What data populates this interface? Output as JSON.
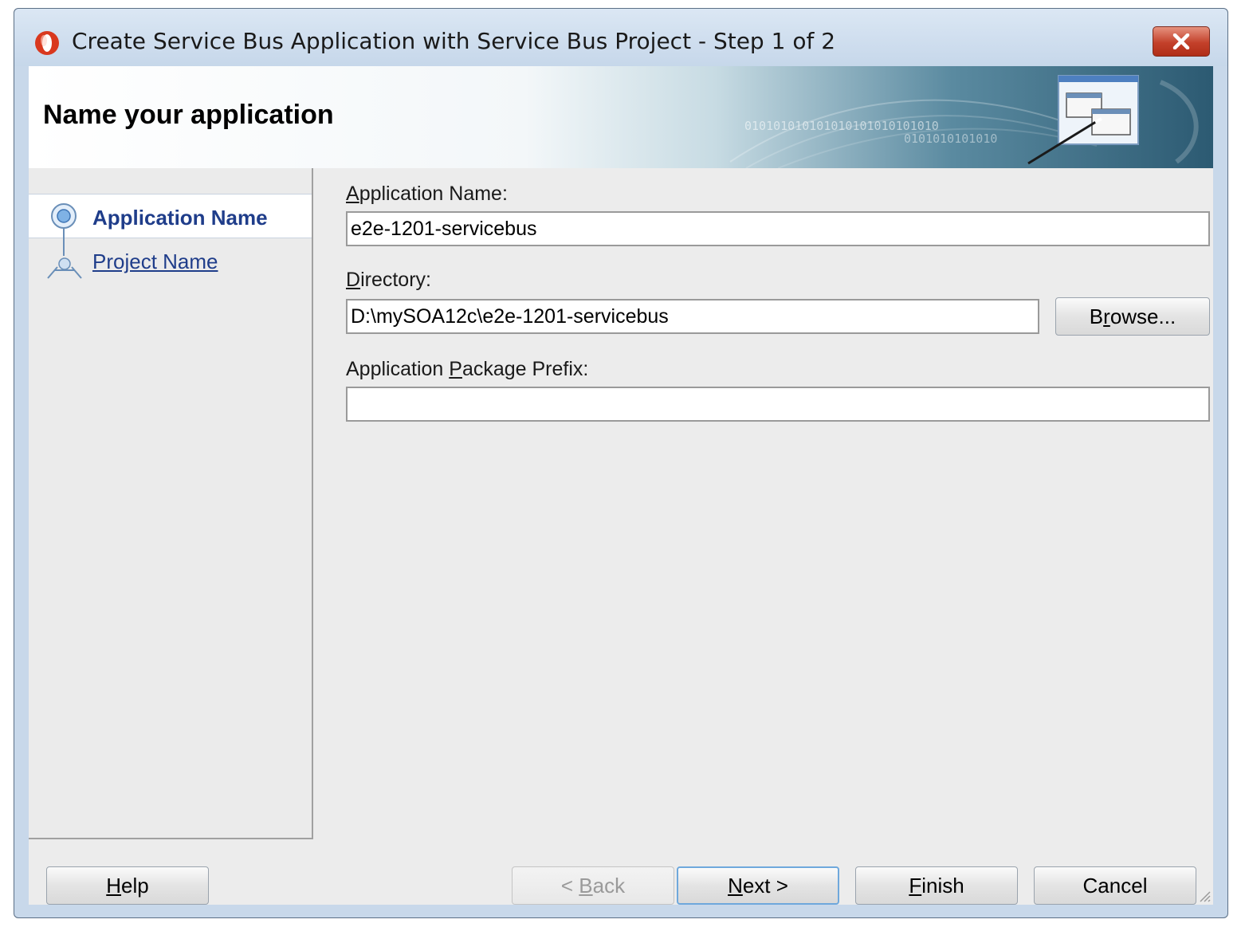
{
  "window": {
    "title": "Create Service Bus Application with Service Bus Project - Step 1 of 2",
    "close_icon": "close-icon"
  },
  "banner": {
    "title": "Name your application",
    "binary_text": "010101010101010101010101010",
    "binary_text2": "0101010101010"
  },
  "steps": [
    {
      "label": "Application Name",
      "state": "active"
    },
    {
      "label": "Project Name",
      "state": "link"
    }
  ],
  "form": {
    "application_name": {
      "label_key": "A",
      "label_rest": "pplication Name:",
      "value": "e2e-1201-servicebus"
    },
    "directory": {
      "label_key": "D",
      "label_rest": "irectory:",
      "value": "D:\\mySOA12c\\e2e-1201-servicebus"
    },
    "package_prefix": {
      "label_pre": "Application ",
      "label_key": "P",
      "label_rest": "ackage Prefix:",
      "value": ""
    },
    "browse": {
      "pre": "B",
      "key": "r",
      "rest": "owse..."
    }
  },
  "buttons": {
    "help": {
      "key": "H",
      "rest": "elp"
    },
    "back": {
      "pre": "< ",
      "key": "B",
      "rest": "ack",
      "enabled": false
    },
    "next": {
      "key": "N",
      "rest": "ext >"
    },
    "finish": {
      "key": "F",
      "rest": "inish"
    },
    "cancel": {
      "label": "Cancel"
    }
  },
  "colors": {
    "accent": "#1f3d8a",
    "close_button": "#c3402a"
  }
}
